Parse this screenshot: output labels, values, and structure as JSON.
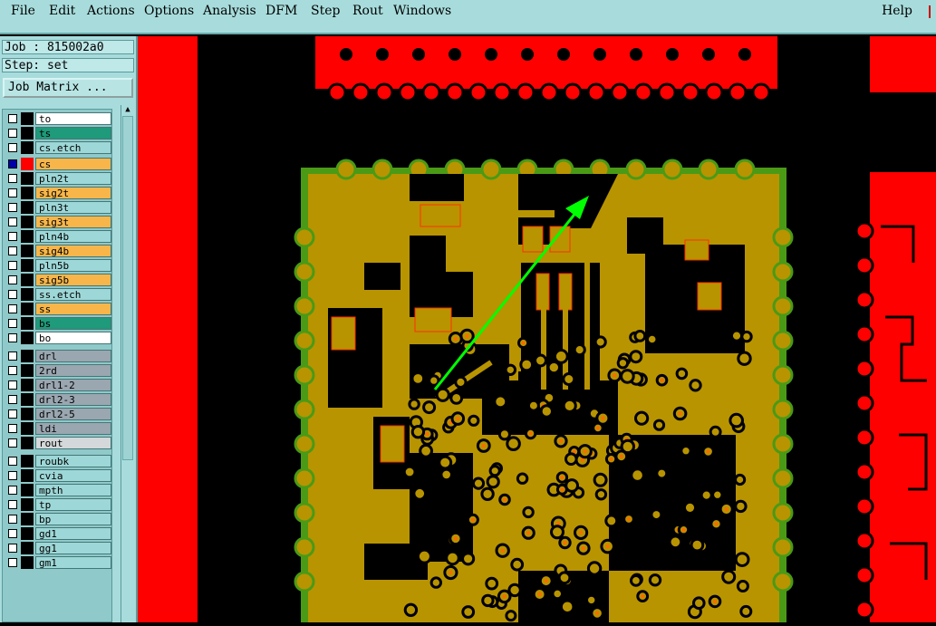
{
  "menu": {
    "items": [
      "File",
      "Edit",
      "Actions",
      "Options",
      "Analysis",
      "DFM",
      "Step",
      "Rout",
      "Windows"
    ],
    "help": "Help"
  },
  "job": {
    "job_label": "Job : ",
    "job_name": "815002a0",
    "step_label": "Step: ",
    "step_name": "set",
    "matrix_button": "Job Matrix ..."
  },
  "layers": [
    {
      "name": "to",
      "color": "#ffffff",
      "checked": false
    },
    {
      "name": "ts",
      "color": "#1f9a7a",
      "checked": false
    },
    {
      "name": "cs.etch",
      "color": "#9ed7d7",
      "checked": false
    },
    {
      "name": "cs",
      "color": "#f8b64a",
      "checked": true,
      "active": true
    },
    {
      "name": "pln2t",
      "color": "#9ed7d7",
      "checked": false
    },
    {
      "name": "sig2t",
      "color": "#f8b64a",
      "checked": false
    },
    {
      "name": "pln3t",
      "color": "#9ed7d7",
      "checked": false
    },
    {
      "name": "sig3t",
      "color": "#f8b64a",
      "checked": false
    },
    {
      "name": "pln4b",
      "color": "#9ed7d7",
      "checked": false
    },
    {
      "name": "sig4b",
      "color": "#f8b64a",
      "checked": false
    },
    {
      "name": "pln5b",
      "color": "#9ed7d7",
      "checked": false
    },
    {
      "name": "sig5b",
      "color": "#f8b64a",
      "checked": false
    },
    {
      "name": "ss.etch",
      "color": "#9ed7d7",
      "checked": false
    },
    {
      "name": "ss",
      "color": "#f8b64a",
      "checked": false
    },
    {
      "name": "bs",
      "color": "#1f9a7a",
      "checked": false
    },
    {
      "name": "bo",
      "color": "#ffffff",
      "checked": false
    },
    {
      "name": "drl",
      "color": "#9aa6b0",
      "checked": false
    },
    {
      "name": "2rd",
      "color": "#9aa6b0",
      "checked": false
    },
    {
      "name": "drl1-2",
      "color": "#9aa6b0",
      "checked": false
    },
    {
      "name": "drl2-3",
      "color": "#9aa6b0",
      "checked": false
    },
    {
      "name": "drl2-5",
      "color": "#9aa6b0",
      "checked": false
    },
    {
      "name": "ldi",
      "color": "#9aa6b0",
      "checked": false
    },
    {
      "name": "rout",
      "color": "#d4d8da",
      "checked": false
    },
    {
      "name": "roubk",
      "color": "#9ed7d7",
      "checked": false
    },
    {
      "name": "cvia",
      "color": "#9ed7d7",
      "checked": false
    },
    {
      "name": "mpth",
      "color": "#9ed7d7",
      "checked": false
    },
    {
      "name": "tp",
      "color": "#9ed7d7",
      "checked": false
    },
    {
      "name": "bp",
      "color": "#9ed7d7",
      "checked": false
    },
    {
      "name": "gd1",
      "color": "#9ed7d7",
      "checked": false
    },
    {
      "name": "gg1",
      "color": "#9ed7d7",
      "checked": false
    },
    {
      "name": "gm1",
      "color": "#9ed7d7",
      "checked": false
    }
  ],
  "colors": {
    "pcb_red": "#ff0000",
    "pcb_gold": "#b89400",
    "pcb_green": "#4a9a16",
    "measure_line": "#00ff00",
    "copper_dots": "#ff6a00"
  }
}
